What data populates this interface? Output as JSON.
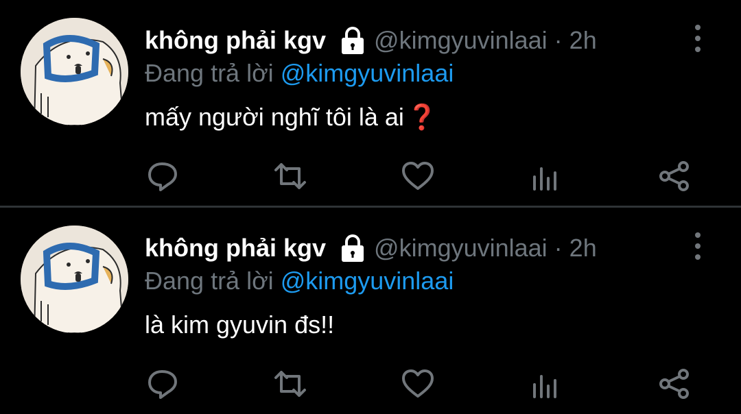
{
  "colors": {
    "background": "#000000",
    "text": "#ffffff",
    "muted": "#6e767d",
    "link": "#1d9bf0",
    "divider": "#2f3336",
    "question_mark": "#e0232e"
  },
  "tweets": [
    {
      "display_name": "không phải kgv",
      "handle": "@kimgyuvinlaai",
      "separator": "·",
      "time": "2h",
      "reply_prefix": "Đang trả lời",
      "reply_to": "@kimgyuvinlaai",
      "text": "mấy người nghĩ tôi là ai",
      "emoji": "❓",
      "icons": [
        "lock-icon",
        "more-icon",
        "reply-icon",
        "retweet-icon",
        "like-icon",
        "analytics-icon",
        "share-icon"
      ]
    },
    {
      "display_name": "không phải kgv",
      "handle": "@kimgyuvinlaai",
      "separator": "·",
      "time": "2h",
      "reply_prefix": "Đang trả lời",
      "reply_to": "@kimgyuvinlaai",
      "text": "là kim gyuvin đs!!",
      "icons": [
        "lock-icon",
        "more-icon",
        "reply-icon",
        "retweet-icon",
        "like-icon",
        "analytics-icon",
        "share-icon"
      ]
    }
  ]
}
